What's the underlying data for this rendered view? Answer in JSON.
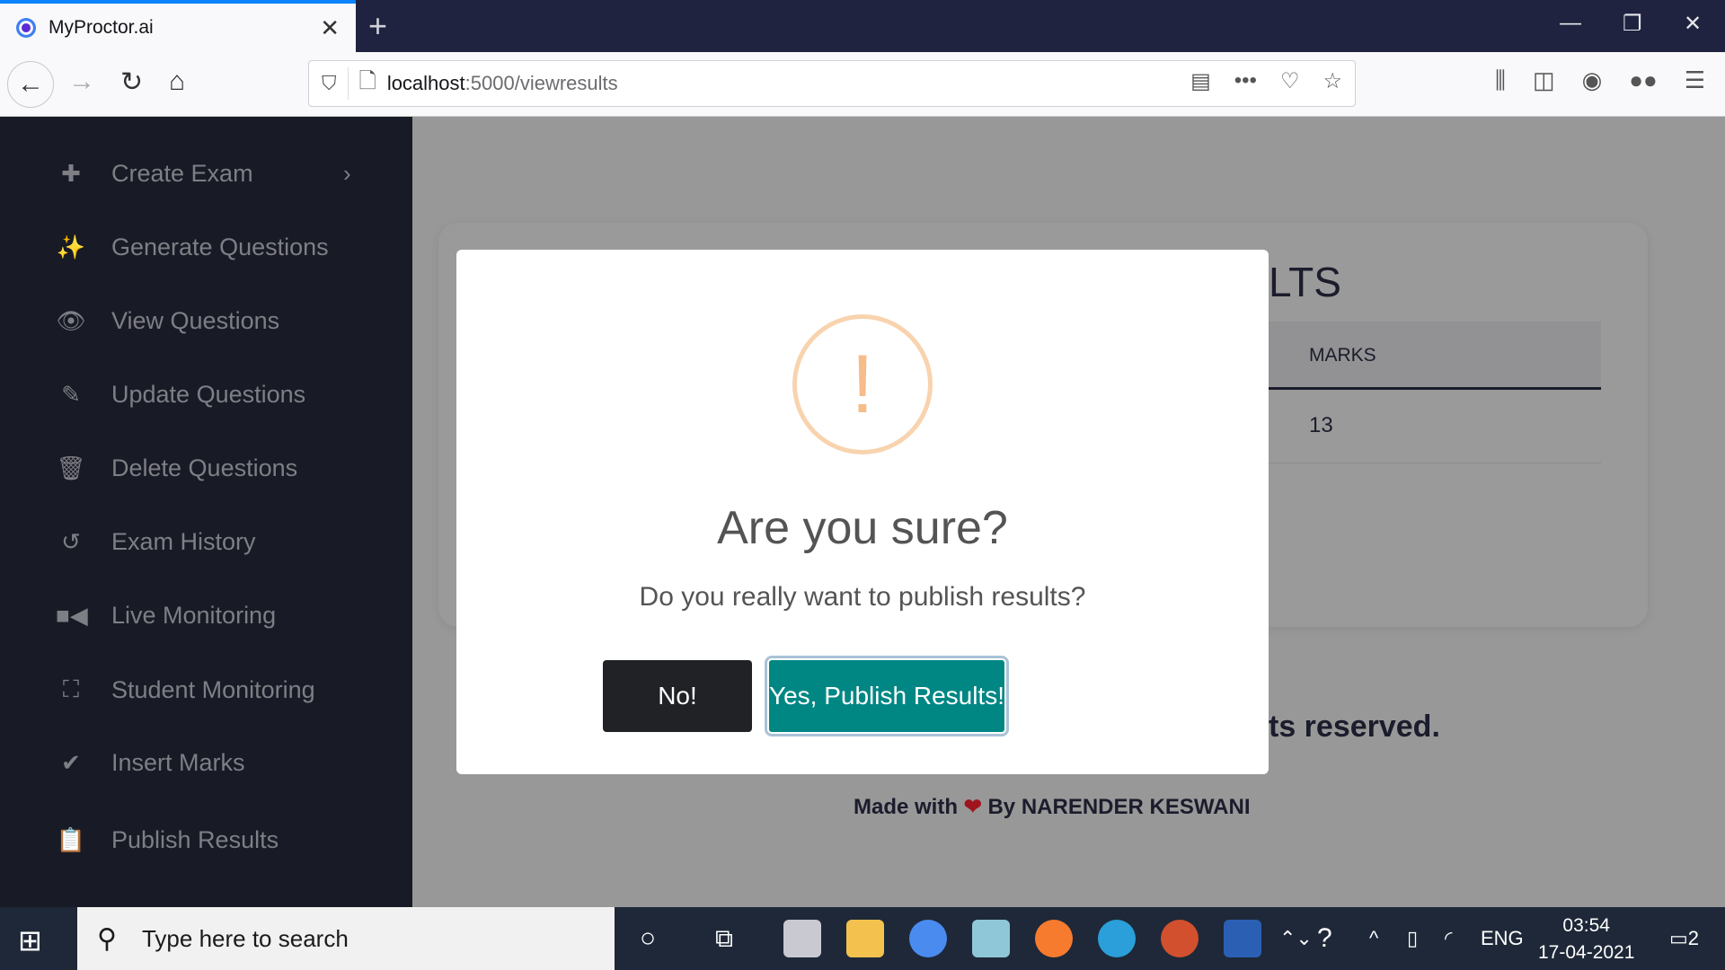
{
  "browser": {
    "tab_title": "MyProctor.ai",
    "url_host": "localhost",
    "url_rest": ":5000/viewresults"
  },
  "sidebar": {
    "items": [
      {
        "label": "Create Exam",
        "icon": "plus-icon",
        "has_submenu": true
      },
      {
        "label": "Generate Questions",
        "icon": "magic-wand-icon"
      },
      {
        "label": "View Questions",
        "icon": "eye-icon"
      },
      {
        "label": "Update Questions",
        "icon": "edit-icon"
      },
      {
        "label": "Delete Questions",
        "icon": "trash-icon"
      },
      {
        "label": "Exam History",
        "icon": "history-icon"
      },
      {
        "label": "Live Monitoring",
        "icon": "video-camera-icon"
      },
      {
        "label": "Student Monitoring",
        "icon": "binoculars-icon"
      },
      {
        "label": "Insert Marks",
        "icon": "spell-check-icon"
      },
      {
        "label": "Publish Results",
        "icon": "clipboard-check-icon"
      }
    ]
  },
  "page": {
    "title_partial": "LTS",
    "table_header": "MARKS",
    "table_value": "13",
    "rights_partial": "ts reserved.",
    "made_with_prefix": "Made with",
    "made_with_heart": "❤",
    "made_with_suffix": "By NARENDER KESWANI"
  },
  "dialog": {
    "icon": "!",
    "title": "Are you sure?",
    "text": "Do you really want to publish results?",
    "cancel_label": "No!",
    "confirm_label": "Yes, Publish Results!",
    "colors": {
      "confirm": "#008784",
      "cancel": "#202226",
      "warning": "#f6bc8a"
    }
  },
  "taskbar": {
    "search_placeholder": "Type here to search",
    "language": "ENG",
    "time": "03:54",
    "date": "17-04-2021",
    "notification_count": "2"
  }
}
